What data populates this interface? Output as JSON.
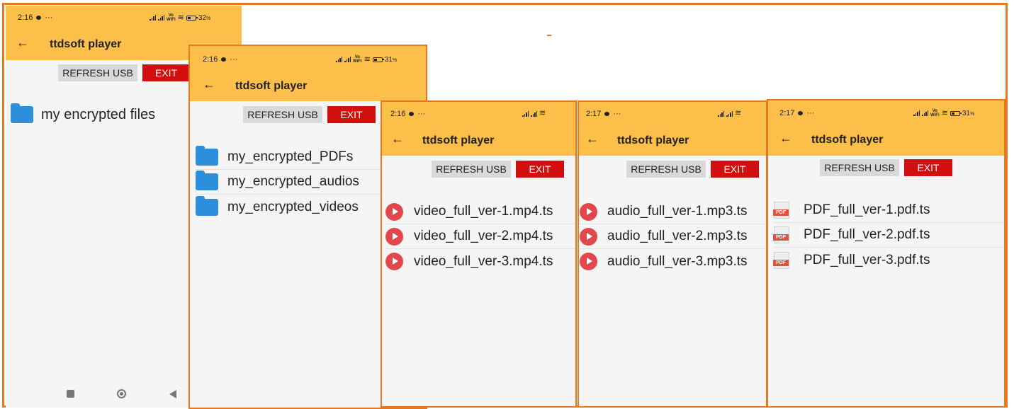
{
  "app": {
    "title": "ttdsoft player",
    "refresh_label": "REFRESH USB",
    "exit_label": "EXIT"
  },
  "colors": {
    "appbar": "#fbbf4a",
    "exit": "#d10f0f",
    "folder": "#2d8fdc",
    "play": "#e2474b",
    "pdf": "#e0533a",
    "frame": "#e87722"
  },
  "screens": [
    {
      "time": "2:16",
      "battery": "32",
      "items": [
        {
          "label": "my encrypted files",
          "icon": "folder-icon"
        }
      ]
    },
    {
      "time": "2:16",
      "battery": "31",
      "items": [
        {
          "label": "my_encrypted_PDFs",
          "icon": "folder-icon"
        },
        {
          "label": "my_encrypted_audios",
          "icon": "folder-icon"
        },
        {
          "label": "my_encrypted_videos",
          "icon": "folder-icon"
        }
      ]
    },
    {
      "time": "2:16",
      "battery": "",
      "items": [
        {
          "label": "video_full_ver-1.mp4.ts",
          "icon": "play-icon"
        },
        {
          "label": "video_full_ver-2.mp4.ts",
          "icon": "play-icon"
        },
        {
          "label": "video_full_ver-3.mp4.ts",
          "icon": "play-icon"
        }
      ]
    },
    {
      "time": "2:17",
      "battery": "",
      "items": [
        {
          "label": "audio_full_ver-1.mp3.ts",
          "icon": "play-icon"
        },
        {
          "label": "audio_full_ver-2.mp3.ts",
          "icon": "play-icon"
        },
        {
          "label": "audio_full_ver-3.mp3.ts",
          "icon": "play-icon"
        }
      ]
    },
    {
      "time": "2:17",
      "battery": "31",
      "items": [
        {
          "label": "PDF_full_ver-1.pdf.ts",
          "icon": "pdf-icon"
        },
        {
          "label": "PDF_full_ver-2.pdf.ts",
          "icon": "pdf-icon"
        },
        {
          "label": "PDF_full_ver-3.pdf.ts",
          "icon": "pdf-icon"
        }
      ]
    }
  ],
  "status": {
    "dots": "···",
    "vowifi": "Vo\nWiFi",
    "percent": "%"
  },
  "pdf_badge": "PDF"
}
